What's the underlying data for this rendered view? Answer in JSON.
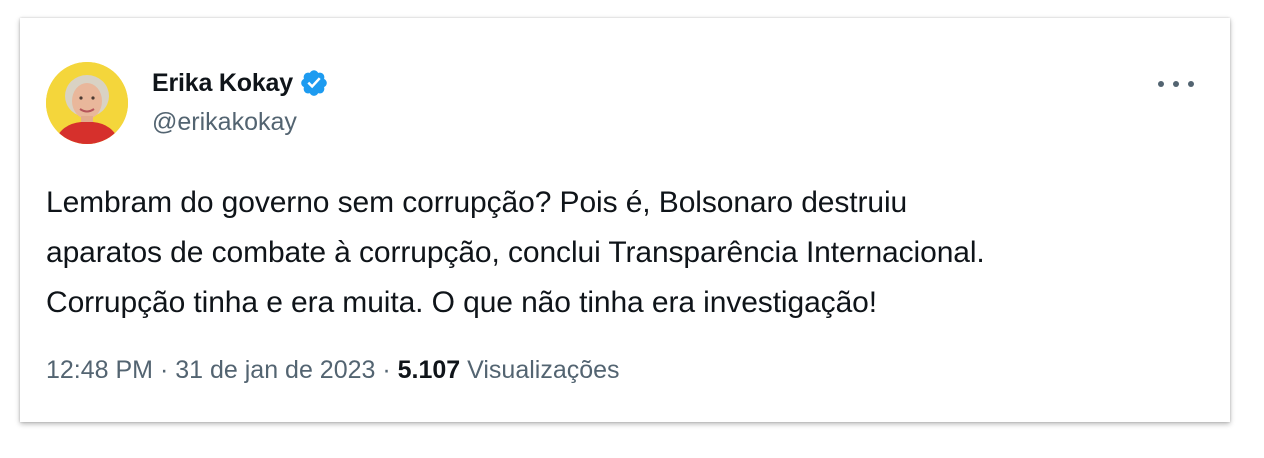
{
  "tweet": {
    "author_name": "Erika Kokay",
    "handle": "@erikakokay",
    "lines": [
      "Lembram do governo sem corrupção? Pois é, Bolsonaro destruiu",
      "aparatos de combate à corrupção, conclui Transparência Internacional.",
      "Corrupção tinha e era muita. O que não tinha era investigação!"
    ],
    "time": "12:48 PM",
    "separator": " · ",
    "date": "31 de jan de 2023",
    "views_count": "5.107",
    "views_label": "Visualizações"
  },
  "icons": {
    "verified": "verified-badge-icon",
    "more": "more-options-icon"
  },
  "colors": {
    "verified_blue": "#1d9bf0",
    "text_primary": "#0f1419",
    "text_secondary": "#536471",
    "avatar_bg": "#f4d63b"
  }
}
